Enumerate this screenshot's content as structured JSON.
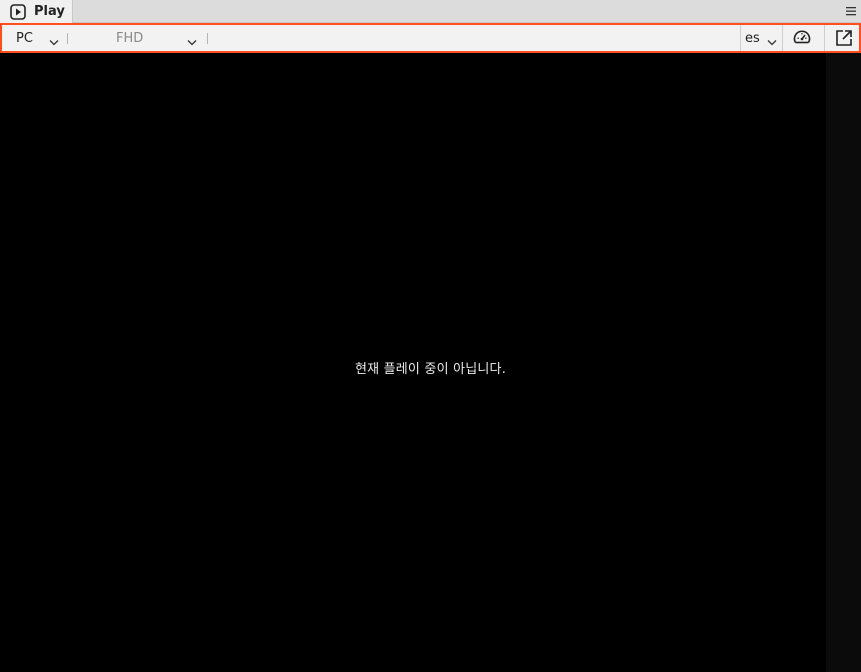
{
  "tab": {
    "label": "Play",
    "icon": "play-icon"
  },
  "toolbar": {
    "device_select": {
      "value": "PC"
    },
    "quality_select": {
      "value": "FHD"
    },
    "language_select": {
      "value": "es"
    },
    "speed_icon": "speedometer-icon",
    "popout_icon": "external-window-icon"
  },
  "player": {
    "status_message": "현재 플레이 중이 아닙니다."
  },
  "colors": {
    "accent_border": "#ff4f1f",
    "player_background": "#000000"
  }
}
